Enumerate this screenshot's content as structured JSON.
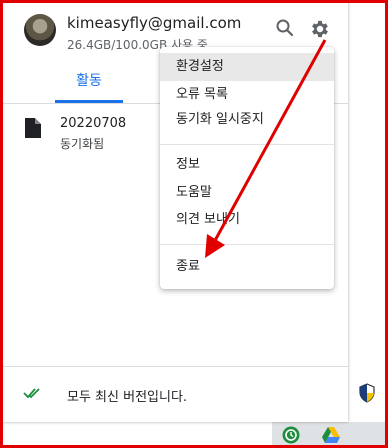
{
  "account": {
    "email": "kimeasyfly@gmail.com",
    "storage": "26.4GB/100.0GB 사용 중"
  },
  "header": {
    "search_icon": "search-icon",
    "settings_icon": "gear-icon"
  },
  "tabs": [
    {
      "label": "활동",
      "active": true
    }
  ],
  "activity": [
    {
      "name": "20220708",
      "status": "동기화됨",
      "icon": "document-icon"
    }
  ],
  "footer": {
    "status_text": "모두 최신 버전입니다.",
    "icon": "double-check-icon"
  },
  "settings_menu": {
    "items": [
      "환경설정",
      "오류 목록",
      "동기화 일시중지",
      "정보",
      "도움말",
      "의견 보내기",
      "종료"
    ],
    "highlighted": "환경설정"
  },
  "annotation": {
    "color": "#e00000"
  },
  "colors": {
    "accent": "#1a73e8",
    "check": "#1e8e3e",
    "border": "#e00000"
  }
}
